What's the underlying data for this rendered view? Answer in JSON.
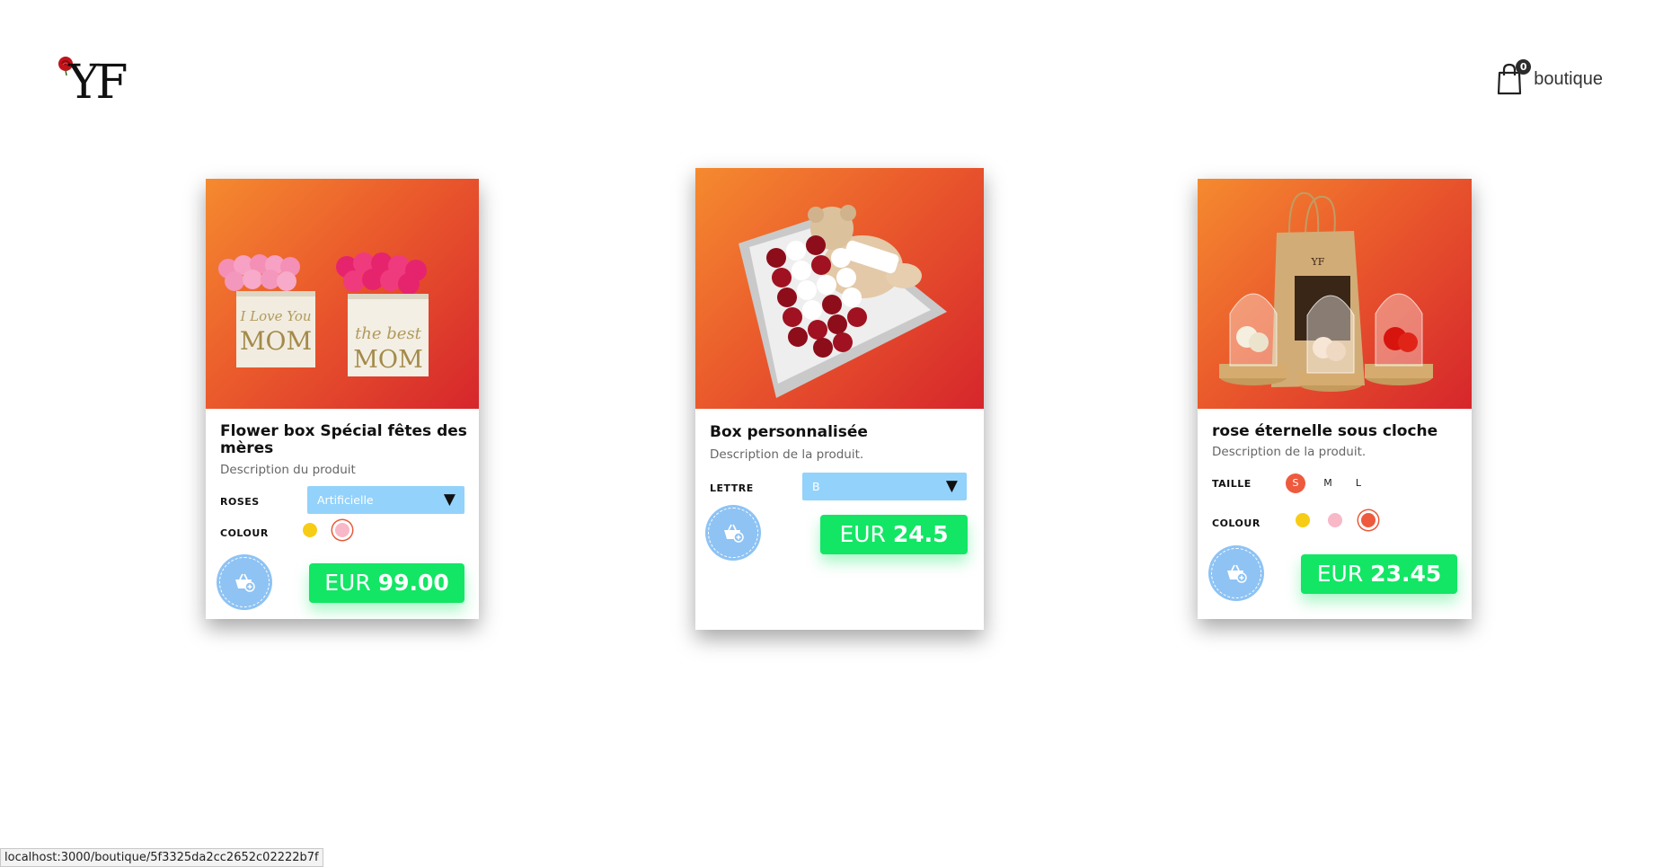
{
  "header": {
    "logo_text": "YF",
    "cart_count": "0",
    "cart_label": "boutique"
  },
  "products": [
    {
      "title_line1": "Flower box Spécial fêtes des",
      "title_line2": "mères",
      "description": "Description du produit",
      "option_label": "ROSES",
      "option_value": "Artificielle",
      "colour_label": "COLOUR",
      "colours": [
        "#f7cc15",
        "#f8b8c8"
      ],
      "selected_colour": 1,
      "price_currency": "EUR",
      "price_amount": "99.00",
      "box_text_1": "I Love You",
      "box_text_2": "MOM",
      "box_text_3": "the best",
      "box_text_4": "MOM"
    },
    {
      "title": "Box personnalisée",
      "description": "Description de la produit.",
      "option_label": "LETTRE",
      "option_value": "B",
      "price_currency": "EUR",
      "price_amount": "24.5"
    },
    {
      "title": "rose éternelle sous cloche",
      "description": "Description de la produit.",
      "size_label": "TAILLE",
      "sizes": [
        "S",
        "M",
        "L"
      ],
      "selected_size": 0,
      "colour_label": "COLOUR",
      "colours": [
        "#f7cc15",
        "#f8b8c8",
        "#ee5a3e"
      ],
      "selected_colour": 2,
      "price_currency": "EUR",
      "price_amount": "23.45",
      "bag_text": "YF"
    }
  ],
  "status_bar": {
    "url": "localhost:3000/boutique/5f3325da2cc2652c02222b7f"
  }
}
